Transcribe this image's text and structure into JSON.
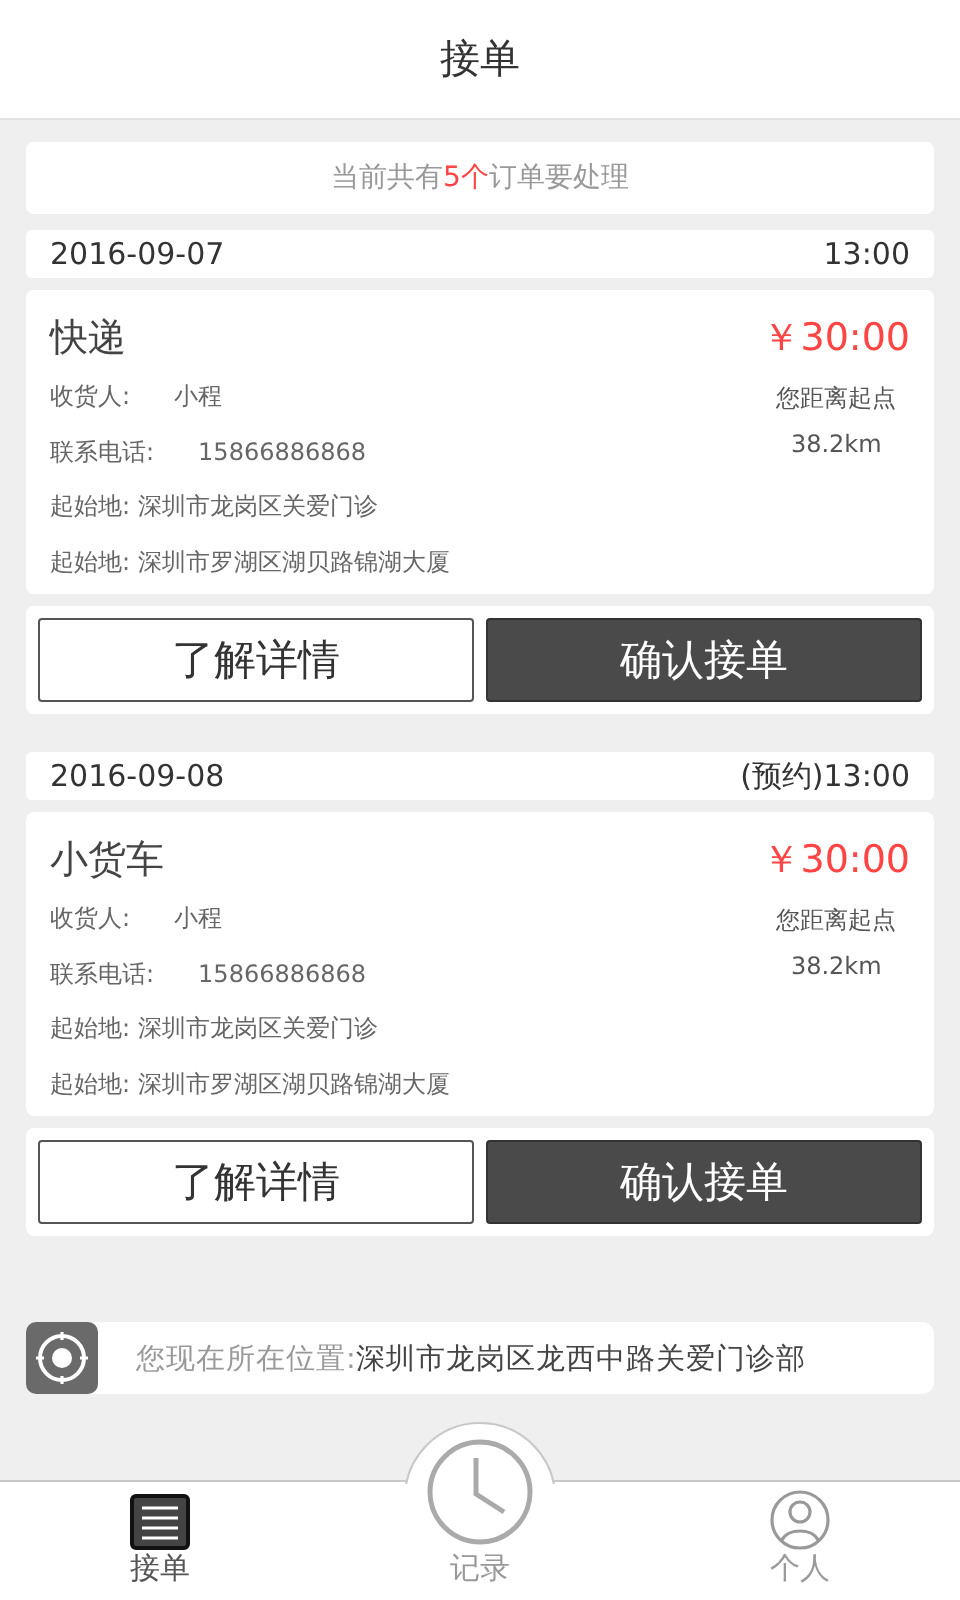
{
  "header": {
    "title": "接单"
  },
  "notice": {
    "text": "当前共有**5个**订单要处理"
  },
  "orders": [
    {
      "date": "2016-09-07",
      "time": "13:00",
      "type": "快递",
      "price": "￥30:00",
      "recipient_label": "收货人:",
      "recipient": "小程",
      "phone_label": "联系电话:",
      "phone": "15866886868",
      "addresses": [
        {
          "label": "起始地:",
          "value": "深圳市龙岗区关爱门诊"
        },
        {
          "label": "起始地:",
          "value": "深圳市罗湖区湖贝路锦湖大厦"
        }
      ],
      "distance_label": "您距离起点",
      "distance": "38.2km",
      "details_button": "了解详情",
      "confirm_button": "确认接单"
    },
    {
      "date": "2016-09-08",
      "time": "(预约)13:00",
      "type": "小货车",
      "price": "￥30:00",
      "recipient_label": "收货人:",
      "recipient": "小程",
      "phone_label": "联系电话:",
      "phone": "15866886868",
      "addresses": [
        {
          "label": "起始地:",
          "value": "深圳市龙岗区关爱门诊"
        },
        {
          "label": "起始地:",
          "value": "深圳市罗湖区湖贝路锦湖大厦"
        }
      ],
      "distance_label": "您距离起点",
      "distance": "38.2km",
      "details_button": "了解详情",
      "confirm_button": "确认接单"
    }
  ],
  "location": {
    "label": "您现在所在位置:",
    "value": "深圳市龙岗区龙西中路关爱门诊部"
  },
  "tabs": [
    {
      "kind": "list",
      "label": "接单",
      "selected": true
    },
    {
      "kind": "clock",
      "label": "记录",
      "selected": false
    },
    {
      "kind": "person",
      "label": "个人",
      "selected": false
    }
  ]
}
